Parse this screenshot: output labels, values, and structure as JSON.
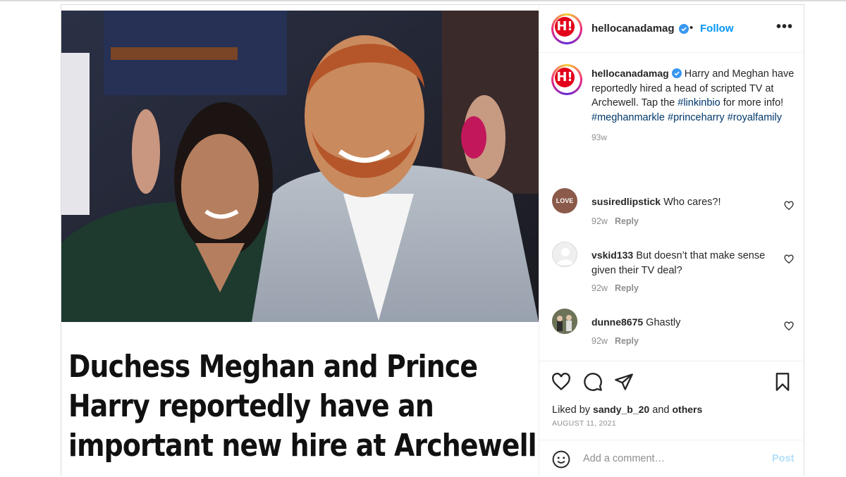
{
  "account": {
    "username": "hellocanadamag",
    "avatar_letters": "H!",
    "follow_label": "Follow",
    "separator": "•",
    "more_label": "•••"
  },
  "caption": {
    "username": "hellocanadamag",
    "text": "Harry and Meghan have reportedly hired a head of scripted TV at Archewell. Tap the",
    "tags": [
      "#linkinbio",
      "#meghanmarkle",
      "#princeharry",
      "#royalfamily"
    ],
    "tail_text": "for more info!",
    "age": "93w"
  },
  "comments": [
    {
      "username": "susiredlipstick",
      "text": "Who cares?!",
      "age": "92w",
      "reply_label": "Reply",
      "avatar_text": "LOVE"
    },
    {
      "username": "vskid133",
      "text": "But doesn’t that make sense given their TV deal?",
      "age": "92w",
      "reply_label": "Reply"
    },
    {
      "username": "dunne8675",
      "text": "Ghastly",
      "age": "92w",
      "reply_label": "Reply"
    }
  ],
  "post_image": {
    "headline_lines": [
      "Duchess Meghan and Prince",
      "Harry reportedly have an",
      "important new hire at Archewell"
    ]
  },
  "likes": {
    "prefix": "Liked by",
    "user": "sandy_b_20",
    "and": "and",
    "others": "others"
  },
  "date": "AUGUST 11, 2021",
  "add_comment": {
    "placeholder": "Add a comment…",
    "post_label": "Post"
  },
  "colors": {
    "link": "#0095f6",
    "hashtag": "#00376b",
    "brand": "#e3001b",
    "muted": "#8e8e8e"
  }
}
